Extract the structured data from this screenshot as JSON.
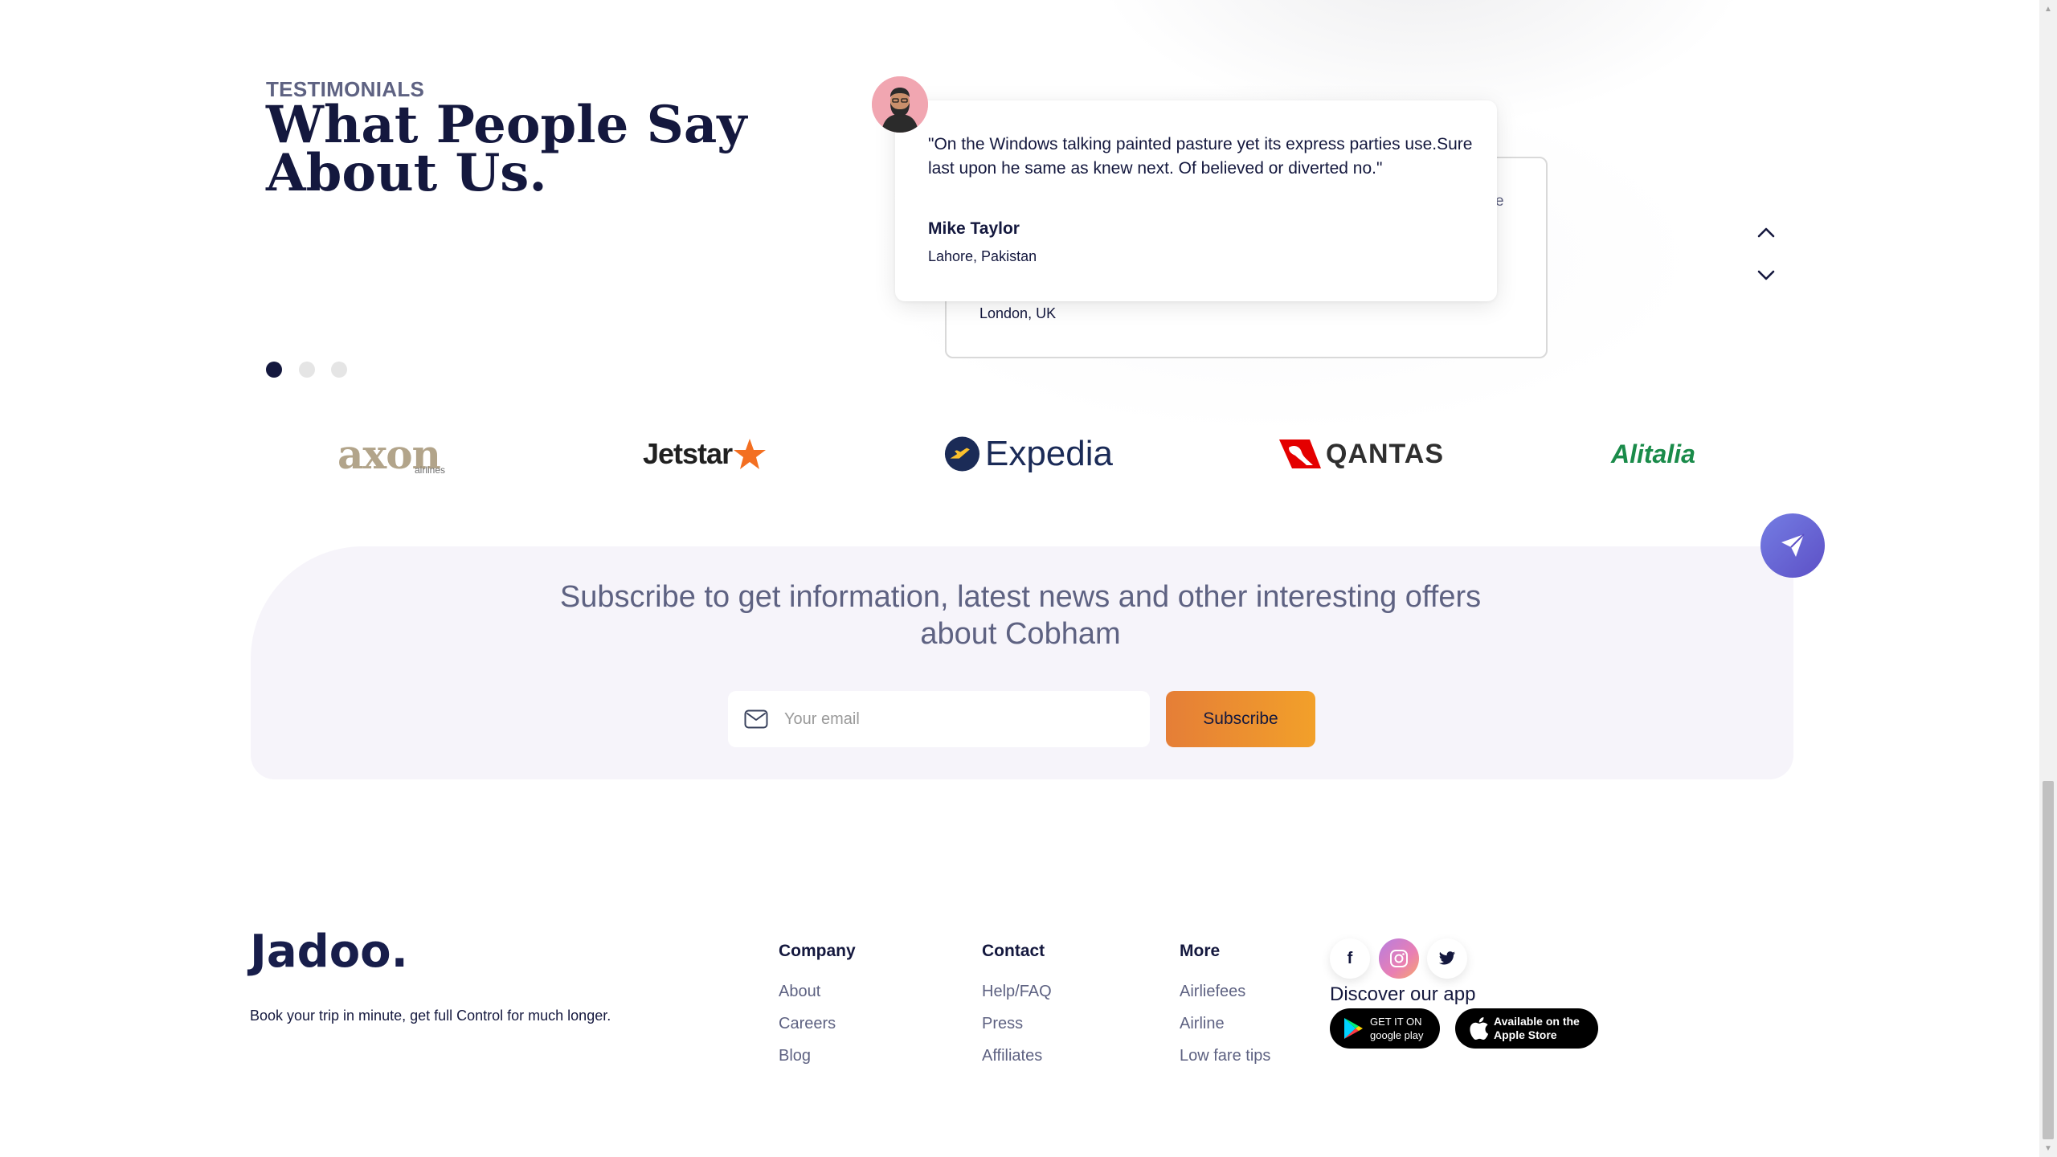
{
  "testimonials": {
    "eyebrow": "TESTIMONIALS",
    "heading": "What People Say About Us.",
    "front_card": {
      "quote": "\"On the Windows talking painted pasture yet its express parties use.Sure last upon he same as knew next. Of believed or diverted no.\"",
      "author": "Mike Taylor",
      "location": "Lahore, Pakistan"
    },
    "back_card": {
      "peek_text": "e",
      "location": "London, UK"
    },
    "dots": {
      "count": 3,
      "active_index": 0
    },
    "arrows": {
      "up_icon": "chevron-up-icon",
      "down_icon": "chevron-down-icon"
    }
  },
  "partners": [
    "axon",
    "Jetstar",
    "Expedia",
    "QANTAS",
    "Alitalia"
  ],
  "partners_sub": {
    "axon": "airlines"
  },
  "subscribe": {
    "title": "Subscribe to get information, latest news and other interesting offers about Cobham",
    "email_placeholder": "Your email",
    "email_icon": "mail-icon",
    "button_label": "Subscribe",
    "badge_icon": "send-icon"
  },
  "footer": {
    "brand": "Jadoo.",
    "tagline": "Book your trip in minute, get full Control for much longer.",
    "columns": [
      {
        "title": "Company",
        "links": [
          "About",
          "Careers",
          "Blog"
        ]
      },
      {
        "title": "Contact",
        "links": [
          "Help/FAQ",
          "Press",
          "Affiliates"
        ]
      },
      {
        "title": "More",
        "links": [
          "Airliefees",
          "Airline",
          "Low fare tips"
        ]
      }
    ],
    "social": [
      {
        "name": "facebook-icon",
        "glyph": "f"
      },
      {
        "name": "instagram-icon",
        "glyph": ""
      },
      {
        "name": "twitter-icon",
        "glyph": ""
      }
    ],
    "discover_label": "Discover our app",
    "google_play": {
      "line1": "GET IT ON",
      "line2": "google play"
    },
    "app_store": {
      "line1": "Available on the",
      "line2": "Apple Store"
    }
  },
  "colors": {
    "heading": "#14183e",
    "muted": "#5e6282",
    "accent_orange": "#f2a02a",
    "accent_purple": "#5d50c6",
    "subscribe_bg": "#f6f4fa"
  }
}
